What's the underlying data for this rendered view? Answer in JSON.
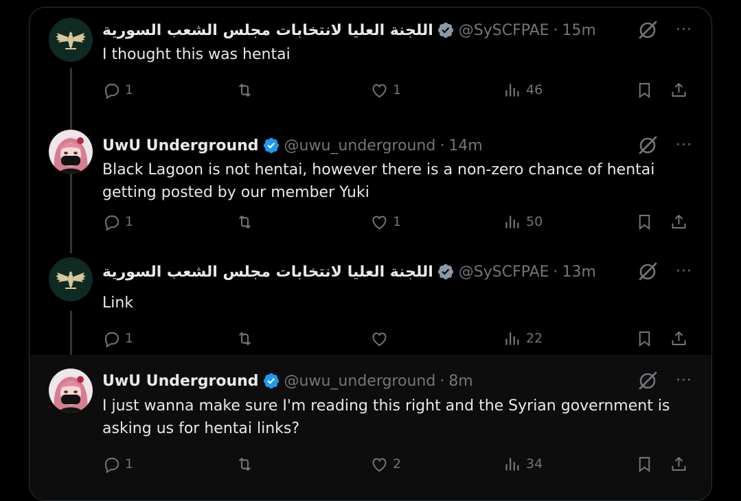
{
  "tweets": [
    {
      "name": "اللجنة العليا لانتخابات مجلس الشعب السورية",
      "handle": "@SySCFPAE",
      "time": "15m",
      "text": "I thought this was hentai",
      "replies": "1",
      "reposts": "",
      "likes": "1",
      "views": "46",
      "avatar": "eagle-emblem"
    },
    {
      "name": "UwU Underground",
      "handle": "@uwu_underground",
      "time": "14m",
      "text": "Black Lagoon is not hentai, however there is a non-zero chance of hentai getting posted by our member Yuki",
      "replies": "1",
      "reposts": "",
      "likes": "1",
      "views": "50",
      "avatar": "anime-girl"
    },
    {
      "name": "اللجنة العليا لانتخابات مجلس الشعب السورية",
      "handle": "@SySCFPAE",
      "time": "13m",
      "text": "Link",
      "replies": "1",
      "reposts": "",
      "likes": "",
      "views": "22",
      "avatar": "eagle-emblem"
    },
    {
      "name": "UwU Underground",
      "handle": "@uwu_underground",
      "time": "8m",
      "text": "I just wanna make sure I'm reading this right and the Syrian government is asking us for hentai links?",
      "replies": "1",
      "reposts": "",
      "likes": "2",
      "views": "34",
      "avatar": "anime-girl"
    }
  ],
  "separator": "·",
  "more_label": "···",
  "colors": {
    "background": "#000000",
    "text": "#e7e9ea",
    "muted": "#71767b",
    "verified": "#1d9bf0",
    "eagle_bg": "#0f2a22",
    "eagle_fg": "#d8c79a"
  }
}
